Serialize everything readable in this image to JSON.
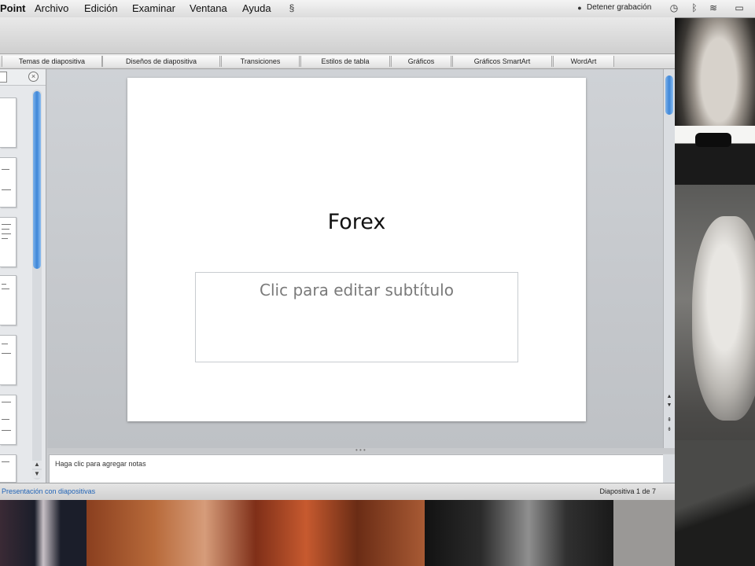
{
  "menubar": {
    "app_name": "Point",
    "menus": [
      "Archivo",
      "Edición",
      "Examinar",
      "Ventana",
      "Ayuda"
    ],
    "recording_label": "Detener grabación"
  },
  "ribbon": {
    "tabs": [
      "Temas de diapositiva",
      "Diseños de diapositiva",
      "Transiciones",
      "Estilos de tabla",
      "Gráficos",
      "Gráficos SmartArt",
      "WordArt"
    ]
  },
  "slide": {
    "title": "Forex",
    "subtitle_placeholder": "Clic para editar subtítulo"
  },
  "notes": {
    "placeholder": "Haga clic para agregar notas"
  },
  "status": {
    "view_label": "Presentación con diapositivas",
    "slide_counter": "Diapositiva 1 de 7"
  },
  "thumbnails_count": 7,
  "colors": {
    "accent": "#3d86d8",
    "status_link": "#1f62b5"
  }
}
